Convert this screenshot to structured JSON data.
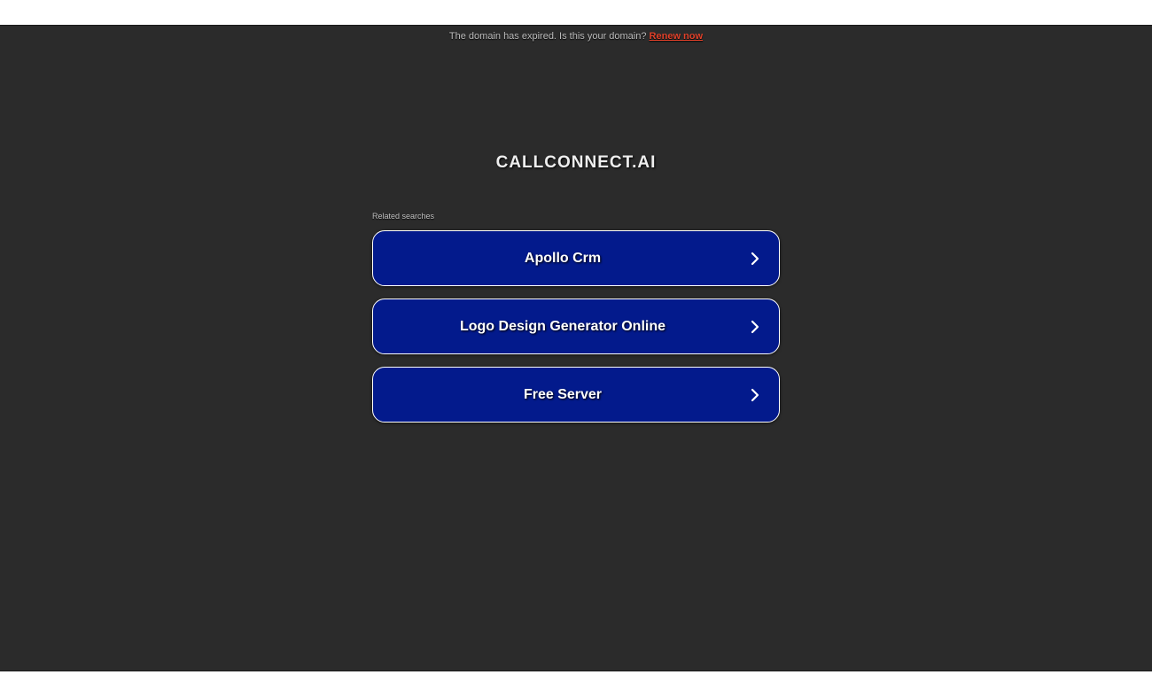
{
  "banner": {
    "message": "The domain has expired. Is this your domain?",
    "renew_label": "Renew now"
  },
  "domain": {
    "title": "CALLCONNECT.AI"
  },
  "related": {
    "heading": "Related searches",
    "items": [
      {
        "label": "Apollo Crm",
        "icon": "chevron-right-icon"
      },
      {
        "label": "Logo Design Generator Online",
        "icon": "chevron-right-icon"
      },
      {
        "label": "Free Server",
        "icon": "chevron-right-icon"
      }
    ]
  },
  "colors": {
    "background": "#2b2b2b",
    "button": "#031a8c",
    "renew": "#e0412a"
  }
}
